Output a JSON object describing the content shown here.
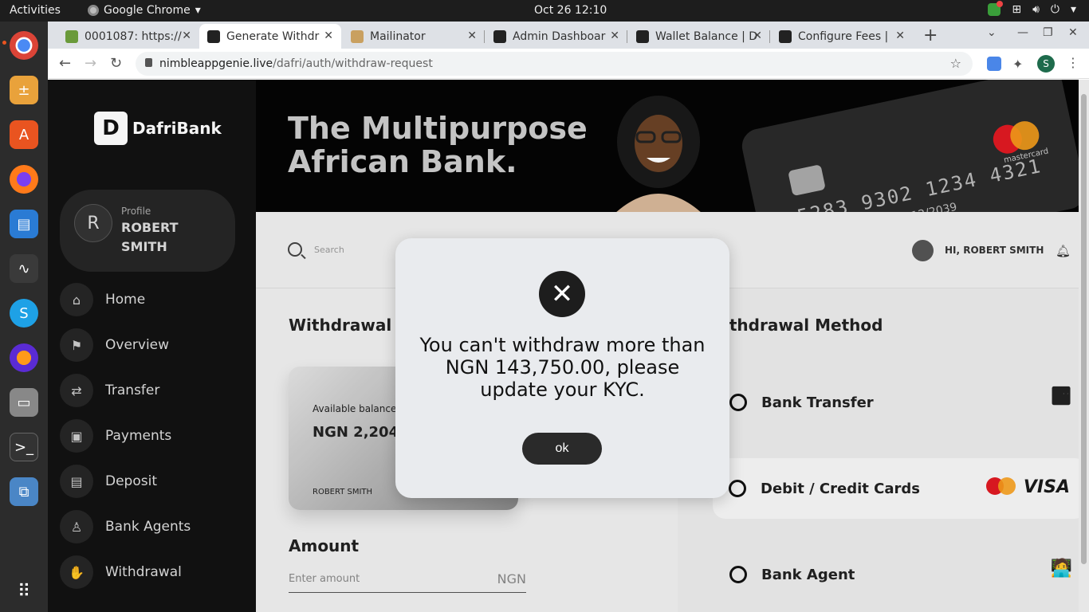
{
  "system": {
    "activities": "Activities",
    "app_name": "Google Chrome",
    "clock": "Oct 26  12:10"
  },
  "browser": {
    "tabs": [
      {
        "title": "0001087: https://"
      },
      {
        "title": "Generate Withdr"
      },
      {
        "title": "Mailinator"
      },
      {
        "title": "Admin Dashboar"
      },
      {
        "title": "Wallet Balance | D"
      },
      {
        "title": "Configure Fees |"
      }
    ],
    "url_host": "nimbleappgenie.live",
    "url_path": "/dafri/auth/withdraw-request",
    "profile_initial": "S"
  },
  "sidebar": {
    "logo_text": "DafriBank",
    "profile_label": "Profile",
    "profile_name": "ROBERT SMITH",
    "profile_initial": "R",
    "items": [
      {
        "label": "Home",
        "icon": "home-icon"
      },
      {
        "label": "Overview",
        "icon": "flag-icon"
      },
      {
        "label": "Transfer",
        "icon": "transfer-icon"
      },
      {
        "label": "Payments",
        "icon": "cash-icon"
      },
      {
        "label": "Deposit",
        "icon": "wallet-icon"
      },
      {
        "label": "Bank Agents",
        "icon": "user-icon"
      },
      {
        "label": "Withdrawal",
        "icon": "handshake-icon"
      }
    ]
  },
  "banner": {
    "headline_1": "The Multipurpose",
    "headline_2": "African Bank.",
    "card_number": "5283 9302 1234 4321",
    "card_expiry": "12/2039",
    "card_brand": "mastercard"
  },
  "header": {
    "search_placeholder": "Search",
    "greeting": "HI, ROBERT SMITH"
  },
  "withdrawal": {
    "title": "Withdrawal",
    "available_label": "Available balance",
    "available_value": "NGN 2,204,",
    "card_holder": "ROBERT SMITH",
    "amount_title": "Amount",
    "amount_placeholder": "Enter amount",
    "amount_currency": "NGN"
  },
  "methods": {
    "title": "ithdrawal Method",
    "options": [
      {
        "label": "Bank Transfer"
      },
      {
        "label": "Debit / Credit Cards"
      },
      {
        "label": "Bank Agent"
      }
    ],
    "visa_label": "VISA"
  },
  "modal": {
    "icon": "close-circle-icon",
    "message": "You can't withdraw more than NGN 143,750.00, please update your KYC.",
    "ok_label": "ok"
  }
}
